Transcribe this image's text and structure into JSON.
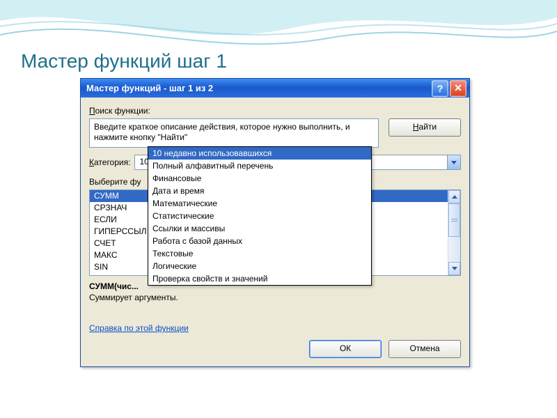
{
  "slide": {
    "title": "Мастер функций шаг 1"
  },
  "dialog": {
    "title": "Мастер функций - шаг 1 из 2",
    "help_glyph": "?",
    "close_glyph": "✕",
    "search_label_pre": "П",
    "search_label_post": "оиск функции:",
    "search_text": "Введите краткое описание действия, которое нужно выполнить, и нажмите кнопку \"Найти\"",
    "find_btn_pre": "Н",
    "find_btn_post": "айти",
    "category_label_pre": "К",
    "category_label_post": "атегория:",
    "category_value": "10 недавно использовавшихся",
    "select_label": "Выберите фу",
    "functions": [
      "СУММ",
      "СРЗНАЧ",
      "ЕСЛИ",
      "ГИПЕРССЫЛ",
      "СЧЕТ",
      "МАКС",
      "SIN"
    ],
    "signature": "СУММ(чис...",
    "description": "Суммирует аргументы.",
    "help_link": "Справка по этой функции",
    "ok": "ОК",
    "cancel": "Отмена"
  },
  "dropdown": {
    "items": [
      "10 недавно использовавшихся",
      "Полный алфавитный перечень",
      "Финансовые",
      "Дата и время",
      "Математические",
      "Статистические",
      "Ссылки и массивы",
      "Работа с базой данных",
      "Текстовые",
      "Логические",
      "Проверка свойств и значений"
    ],
    "selected_index": 0
  }
}
